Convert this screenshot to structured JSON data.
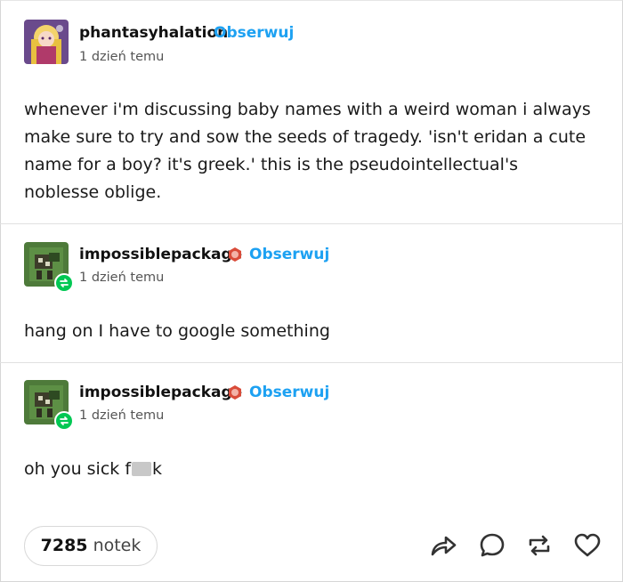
{
  "posts": [
    {
      "username": "phantasyhalation",
      "follow_label": "Obserwuj",
      "time": "1 dzień temu",
      "text": "whenever i'm discussing baby names with a weird woman i always make sure to try and sow the seeds of tragedy. 'isn't eridan a cute name for a boy? it's greek.' this is the pseudointellectual's noblesse oblige."
    },
    {
      "username": "impossiblepackage",
      "follow_label": "Obserwuj",
      "time": "1 dzień temu",
      "text": "hang on I have to google something"
    },
    {
      "username": "impossiblepackage",
      "follow_label": "Obserwuj",
      "time": "1 dzień temu",
      "text_before": "oh you sick f",
      "text_after": "k"
    }
  ],
  "footer": {
    "notes_count": "7285",
    "notes_label": "notek"
  },
  "colors": {
    "follow": "#1da1f2",
    "reblog_badge": "#00c853"
  }
}
